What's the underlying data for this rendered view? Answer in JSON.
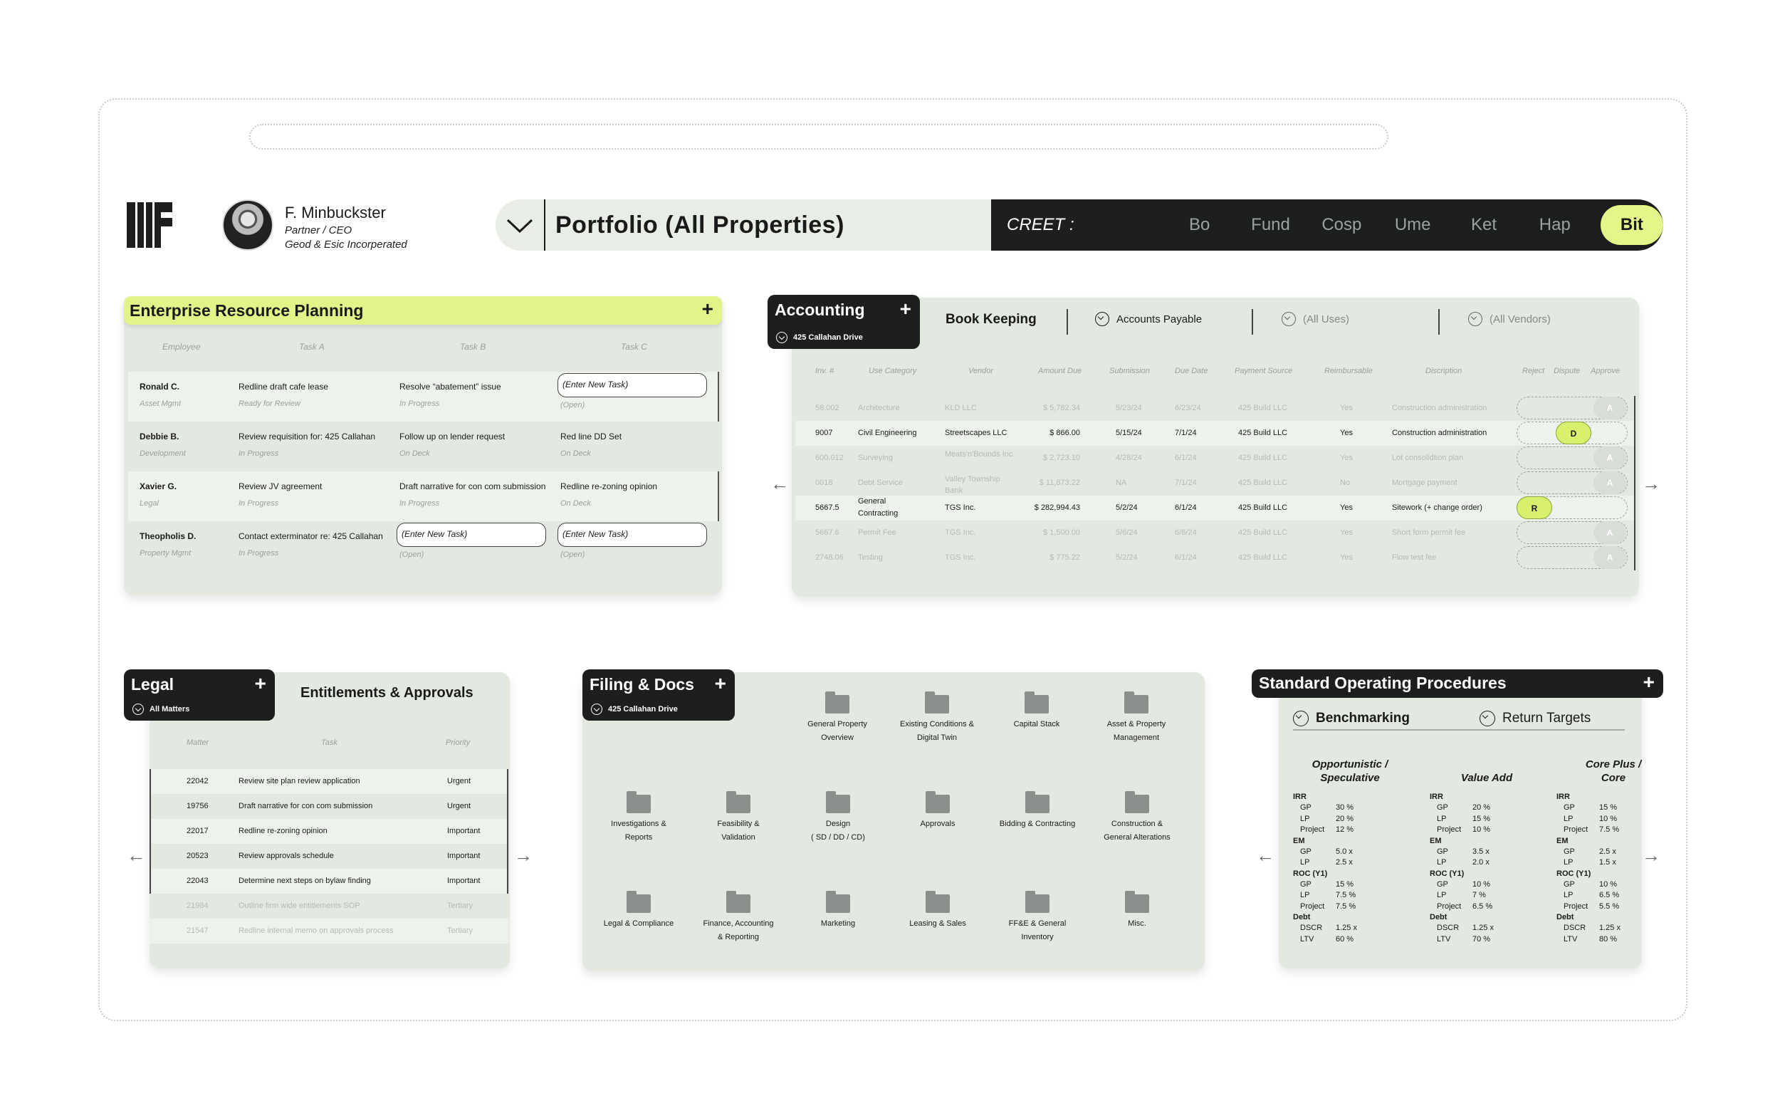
{
  "header": {
    "user": {
      "name": "F. Minbuckster",
      "role": "Partner / CEO",
      "company": "Geod & Esic Incorperated"
    },
    "portfolio": {
      "title": "Portfolio (All Properties)"
    },
    "creet": {
      "label": "CREET :",
      "items": [
        "Bo",
        "Fund",
        "Cosp",
        "Ume",
        "Ket",
        "Hap"
      ],
      "active": "Bit"
    }
  },
  "erp": {
    "title": "Enterprise Resource Planning",
    "columns": [
      "Employee",
      "Task A",
      "Task B",
      "Task C"
    ],
    "rows": [
      {
        "name": "Ronald C.",
        "dept": "Asset Mgmt",
        "a": "Redline draft cafe lease",
        "a_s": "Ready for Review",
        "b": "Resolve “abatement” issue",
        "b_s": "In Progress",
        "c": "(Enter New Task)",
        "c_s": "(Open)"
      },
      {
        "name": "Debbie B.",
        "dept": "Development",
        "a": "Review requisition for: 425 Callahan",
        "a_s": "In Progress",
        "b": "Follow up on lender request",
        "b_s": "On Deck",
        "c": "Red line DD Set",
        "c_s": "On Deck"
      },
      {
        "name": "Xavier G.",
        "dept": "Legal",
        "a": "Review JV agreement",
        "a_s": "In Progress",
        "b": "Draft narrative for con com submission",
        "b_s": "In Progress",
        "c": "Redline re-zoning opinion",
        "c_s": "On Deck"
      },
      {
        "name": "Theopholis D.",
        "dept": "Property Mgmt",
        "a": "Contact exterminator re: 425 Callahan",
        "a_s": "In Progress",
        "b": "(Enter New Task)",
        "b_s": "(Open)",
        "c": "(Enter New Task)",
        "c_s": "(Open)"
      }
    ]
  },
  "accounting": {
    "title": "Accounting",
    "property": "425 Callahan Drive",
    "tabs": {
      "main": "Book Keeping",
      "payable": "Accounts Payable",
      "uses": "(All Uses)",
      "vendors": "(All Vendors)"
    },
    "columns": [
      "Inv. #",
      "Use Category",
      "Vendor",
      "Amount Due",
      "Submission",
      "Due Date",
      "Payment Source",
      "Reimbursable",
      "Discription",
      "Reject",
      "Dispute",
      "Approve"
    ],
    "rows": [
      {
        "inv": "58.002",
        "cat": "Architecture",
        "vendor": "KLD LLC",
        "amt": "$ 5,782.34",
        "sub": "5/23/24",
        "due": "6/23/24",
        "src": "425 Build LLC",
        "reimb": "Yes",
        "desc": "Construction administration",
        "state": "A"
      },
      {
        "inv": "9007",
        "cat": "Civil Engineering",
        "vendor": "Streetscapes LLC",
        "amt": "$ 866.00",
        "sub": "5/15/24",
        "due": "7/1/24",
        "src": "425 Build LLC",
        "reimb": "Yes",
        "desc": "Construction administration",
        "state": "D"
      },
      {
        "inv": "600.012",
        "cat": "Surveying",
        "vendor": "Meats'n'Bounds Inc.",
        "amt": "$ 2,723.10",
        "sub": "4/28/24",
        "due": "6/1/24",
        "src": "425 Build LLC",
        "reimb": "Yes",
        "desc": "Lot consolidtion plan",
        "state": "A"
      },
      {
        "inv": "0018",
        "cat": "Debt Service",
        "vendor": "Valley Township Bank",
        "amt": "$ 11,873.22",
        "sub": "NA",
        "due": "7/1/24",
        "src": "425 Build LLC",
        "reimb": "No",
        "desc": "Mortgage payment",
        "state": "A"
      },
      {
        "inv": "5667.5",
        "cat": "General Contracting",
        "vendor": "TGS Inc.",
        "amt": "$ 282,994.43",
        "sub": "5/2/24",
        "due": "6/1/24",
        "src": "425 Build LLC",
        "reimb": "Yes",
        "desc": "Sitework (+ change order)",
        "state": "R"
      },
      {
        "inv": "5667.6",
        "cat": "Permit Fee",
        "vendor": "TGS Inc.",
        "amt": "$ 1,500.00",
        "sub": "5/6/24",
        "due": "6/6/24",
        "src": "425 Build LLC",
        "reimb": "Yes",
        "desc": "Short form permit fee",
        "state": "A"
      },
      {
        "inv": "2748.06",
        "cat": "Testing",
        "vendor": "TGS Inc.",
        "amt": "$ 775.22",
        "sub": "5/2/24",
        "due": "6/1/24",
        "src": "425 Build LLC",
        "reimb": "Yes",
        "desc": "Flow test fee",
        "state": "A"
      }
    ]
  },
  "legal": {
    "title": "Legal",
    "filter": "All Matters",
    "heading": "Entitlements & Approvals",
    "columns": [
      "Matter",
      "Task",
      "Priority"
    ],
    "rows": [
      {
        "m": "22042",
        "t": "Review site plan review application",
        "p": "Urgent"
      },
      {
        "m": "19756",
        "t": "Draft narrative for con com submission",
        "p": "Urgent"
      },
      {
        "m": "22017",
        "t": "Redline re-zoning opinion",
        "p": "Important"
      },
      {
        "m": "20523",
        "t": "Review approvals schedule",
        "p": "Important"
      },
      {
        "m": "22043",
        "t": "Determine next steps on bylaw finding",
        "p": "Important"
      },
      {
        "m": "21984",
        "t": "Outline firm wide entitlements SOP",
        "p": "Tertiary"
      },
      {
        "m": "21547",
        "t": "Redline internal memo on approvals process",
        "p": "Tertiary"
      }
    ]
  },
  "filing": {
    "title": "Filing & Docs",
    "property": "425 Callahan Drive",
    "folders": [
      [
        "General Property",
        "Overview"
      ],
      [
        "Existing Conditions &",
        "Digital Twin"
      ],
      [
        "Capital Stack",
        ""
      ],
      [
        "Asset & Property",
        "Management"
      ],
      [
        "Investigations &",
        "Reports"
      ],
      [
        "Feasibility &",
        "Validation"
      ],
      [
        "Design",
        "( SD / DD / CD)"
      ],
      [
        "Approvals",
        ""
      ],
      [
        "Bidding & Contracting",
        ""
      ],
      [
        "Construction &",
        "General Alterations"
      ],
      [
        "Legal & Compliance",
        ""
      ],
      [
        "Finance, Accounting",
        "& Reporting"
      ],
      [
        "Marketing",
        ""
      ],
      [
        "Leasing & Sales",
        ""
      ],
      [
        "FF&E & General",
        "Inventory"
      ],
      [
        "Misc.",
        ""
      ]
    ]
  },
  "sop": {
    "title": "Standard Operating Procedures",
    "tabs": [
      "Benchmarking",
      "Return Targets"
    ],
    "columns": [
      {
        "h1": "Opportunistic /",
        "h2": "Speculative",
        "irr": [
          "30 %",
          "20 %",
          "12 %"
        ],
        "em": [
          "5.0 x",
          "2.5 x"
        ],
        "roc": [
          "15 %",
          "7.5 %",
          "7.5 %"
        ],
        "debt": [
          "1.25 x",
          "60 %"
        ]
      },
      {
        "h1": "",
        "h2": "Value Add",
        "irr": [
          "20 %",
          "15 %",
          "10 %"
        ],
        "em": [
          "3.5 x",
          "2.0 x"
        ],
        "roc": [
          "10 %",
          "7 %",
          "6.5 %"
        ],
        "debt": [
          "1.25 x",
          "70 %"
        ]
      },
      {
        "h1": "Core Plus /",
        "h2": "Core",
        "irr": [
          "15 %",
          "10 %",
          "7.5 %"
        ],
        "em": [
          "2.5 x",
          "1.5 x"
        ],
        "roc": [
          "10 %",
          "6.5 %",
          "5.5 %"
        ],
        "debt": [
          "1.25 x",
          "80 %"
        ]
      }
    ],
    "labels": {
      "irr": "IRR",
      "em": "EM",
      "roc": "ROC (Y1)",
      "debt": "Debt",
      "gp": "GP",
      "lp": "LP",
      "project": "Project",
      "dscr": "DSCR",
      "ltv": "LTV"
    }
  }
}
